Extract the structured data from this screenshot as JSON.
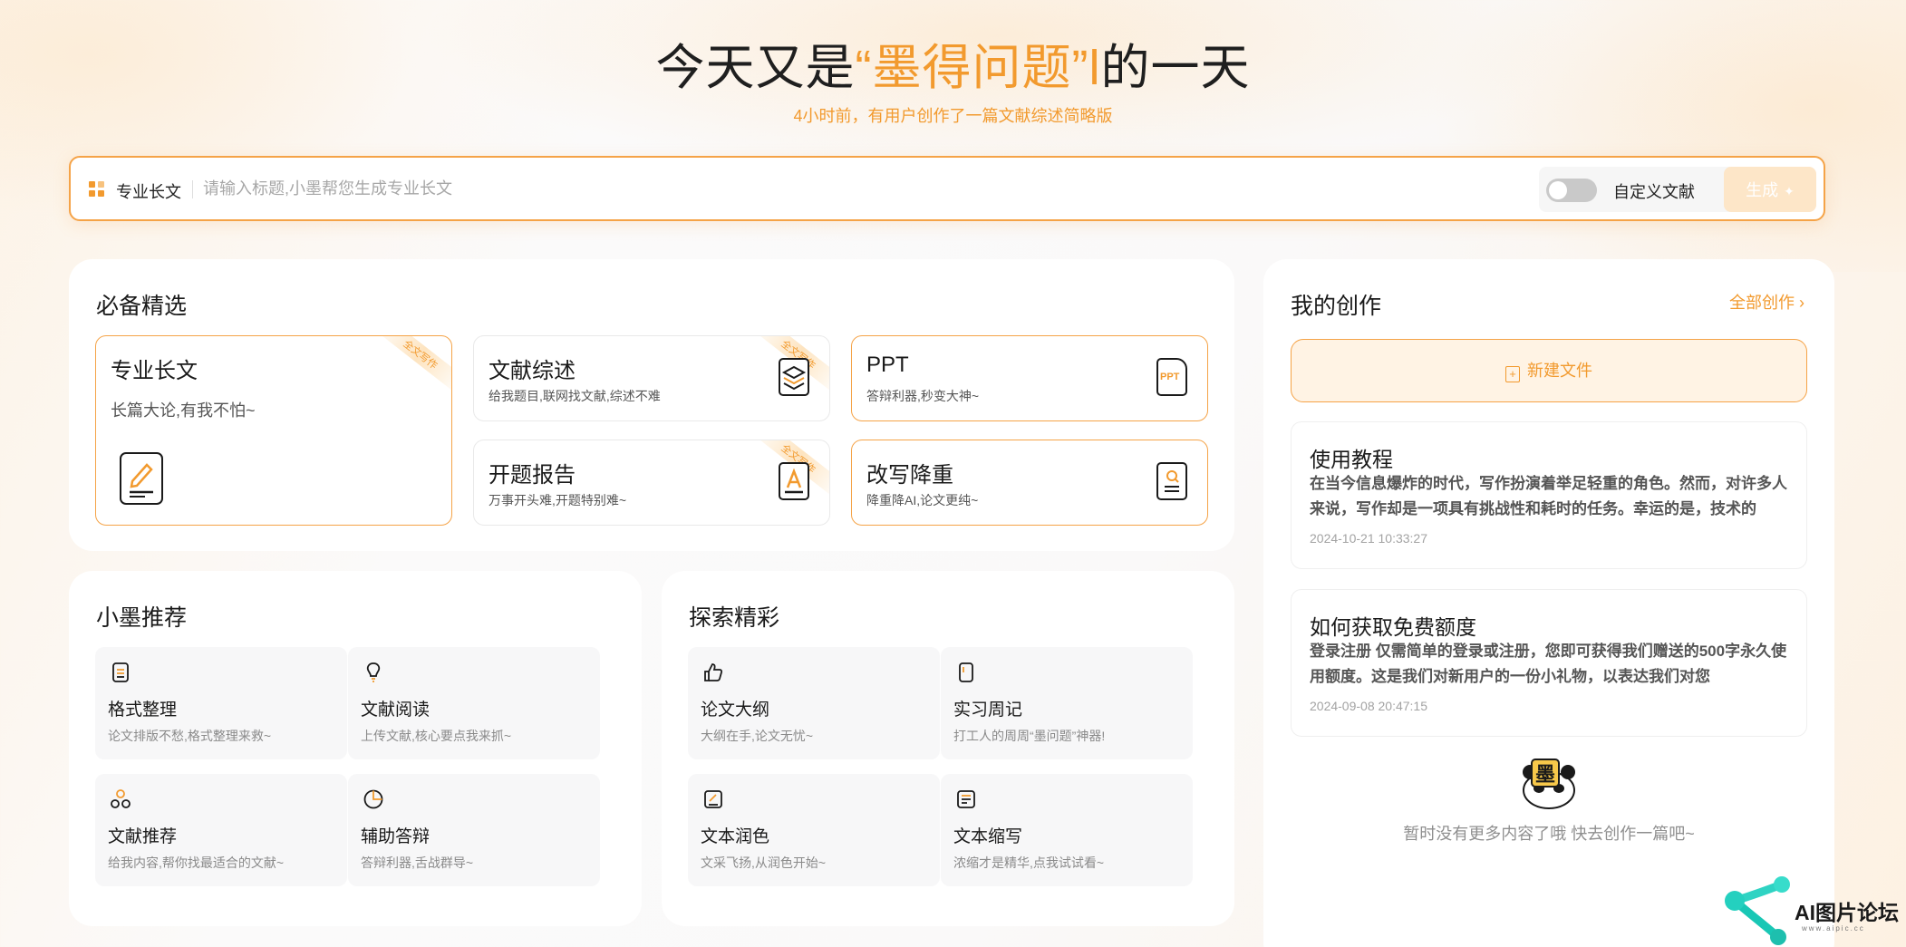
{
  "hero": {
    "title_before": "今天又是",
    "title_highlight": "“墨得问题”",
    "title_caret": "l",
    "title_after": "的一天",
    "subtitle": "4小时前，有用户创作了一篇文献综述简略版"
  },
  "search": {
    "mode_label": "专业长文",
    "placeholder": "请输入标题,小墨帮您生成专业长文",
    "value": "",
    "custom_reference_label": "自定义文献",
    "custom_reference_enabled": false,
    "generate_label": "生成"
  },
  "essentials": {
    "title": "必备精选",
    "badge": "全文写作",
    "cards": [
      {
        "title": "专业长文",
        "desc": "长篇大论,有我不怕~",
        "icon": "edit-document-icon"
      },
      {
        "title": "文献综述",
        "desc": "给我题目,联网找文献,综述不难",
        "icon": "layers-icon"
      },
      {
        "title": "PPT",
        "desc": "答辩利器,秒变大神~",
        "icon": "ppt-file-icon",
        "icon_text": "PPT"
      },
      {
        "title": "开题报告",
        "desc": "万事开头难,开题特别难~",
        "icon": "text-a-icon"
      },
      {
        "title": "改写降重",
        "desc": "降重降AI,论文更纯~",
        "icon": "search-document-icon"
      }
    ]
  },
  "recommend": {
    "title": "小墨推荐",
    "items": [
      {
        "title": "格式整理",
        "desc": "论文排版不愁,格式整理来救~",
        "icon": "stack-icon"
      },
      {
        "title": "文献阅读",
        "desc": "上传文献,核心要点我来抓~",
        "icon": "lightbulb-icon"
      },
      {
        "title": "文献推荐",
        "desc": "给我内容,帮你找最适合的文献~",
        "icon": "cluster-icon"
      },
      {
        "title": "辅助答辩",
        "desc": "答辩利器,舌战群导~",
        "icon": "pie-chart-icon"
      }
    ]
  },
  "explore": {
    "title": "探索精彩",
    "items": [
      {
        "title": "论文大纲",
        "desc": "大纲在手,论文无忧~",
        "icon": "thumbs-up-icon"
      },
      {
        "title": "实习周记",
        "desc": "打工人的周周“墨问题”神器!",
        "icon": "phone-icon"
      },
      {
        "title": "文本润色",
        "desc": "文采飞扬,从润色开始~",
        "icon": "polish-doc-icon"
      },
      {
        "title": "文本缩写",
        "desc": "浓缩才是精华,点我试试看~",
        "icon": "note-icon"
      }
    ]
  },
  "my_creations": {
    "title": "我的创作",
    "all_label": "全部创作",
    "new_file_label": "新建文件",
    "posts": [
      {
        "title": "使用教程",
        "body": "在当今信息爆炸的时代，写作扮演着举足轻重的角色。然而，对许多人来说，写作却是一项具有挑战性和耗时的任务。幸运的是，技术的",
        "time": "2024-10-21 10:33:27"
      },
      {
        "title": "如何获取免费额度",
        "body": "登录注册 仅需简单的登录或注册，您即可获得我们赠送的500字永久使用额度。这是我们对新用户的一份小礼物，以表达我们对您",
        "time": "2024-09-08 20:47:15"
      }
    ],
    "empty_text": "暂时没有更多内容了哦 快去创作一篇吧~",
    "mascot_char": "墨"
  },
  "watermark": {
    "text": "AI图片论坛",
    "url": "www.aipic.cc"
  },
  "colors": {
    "accent": "#f29a2e",
    "accent_light": "#fde6c8",
    "card_bg": "#f7f7f8"
  }
}
